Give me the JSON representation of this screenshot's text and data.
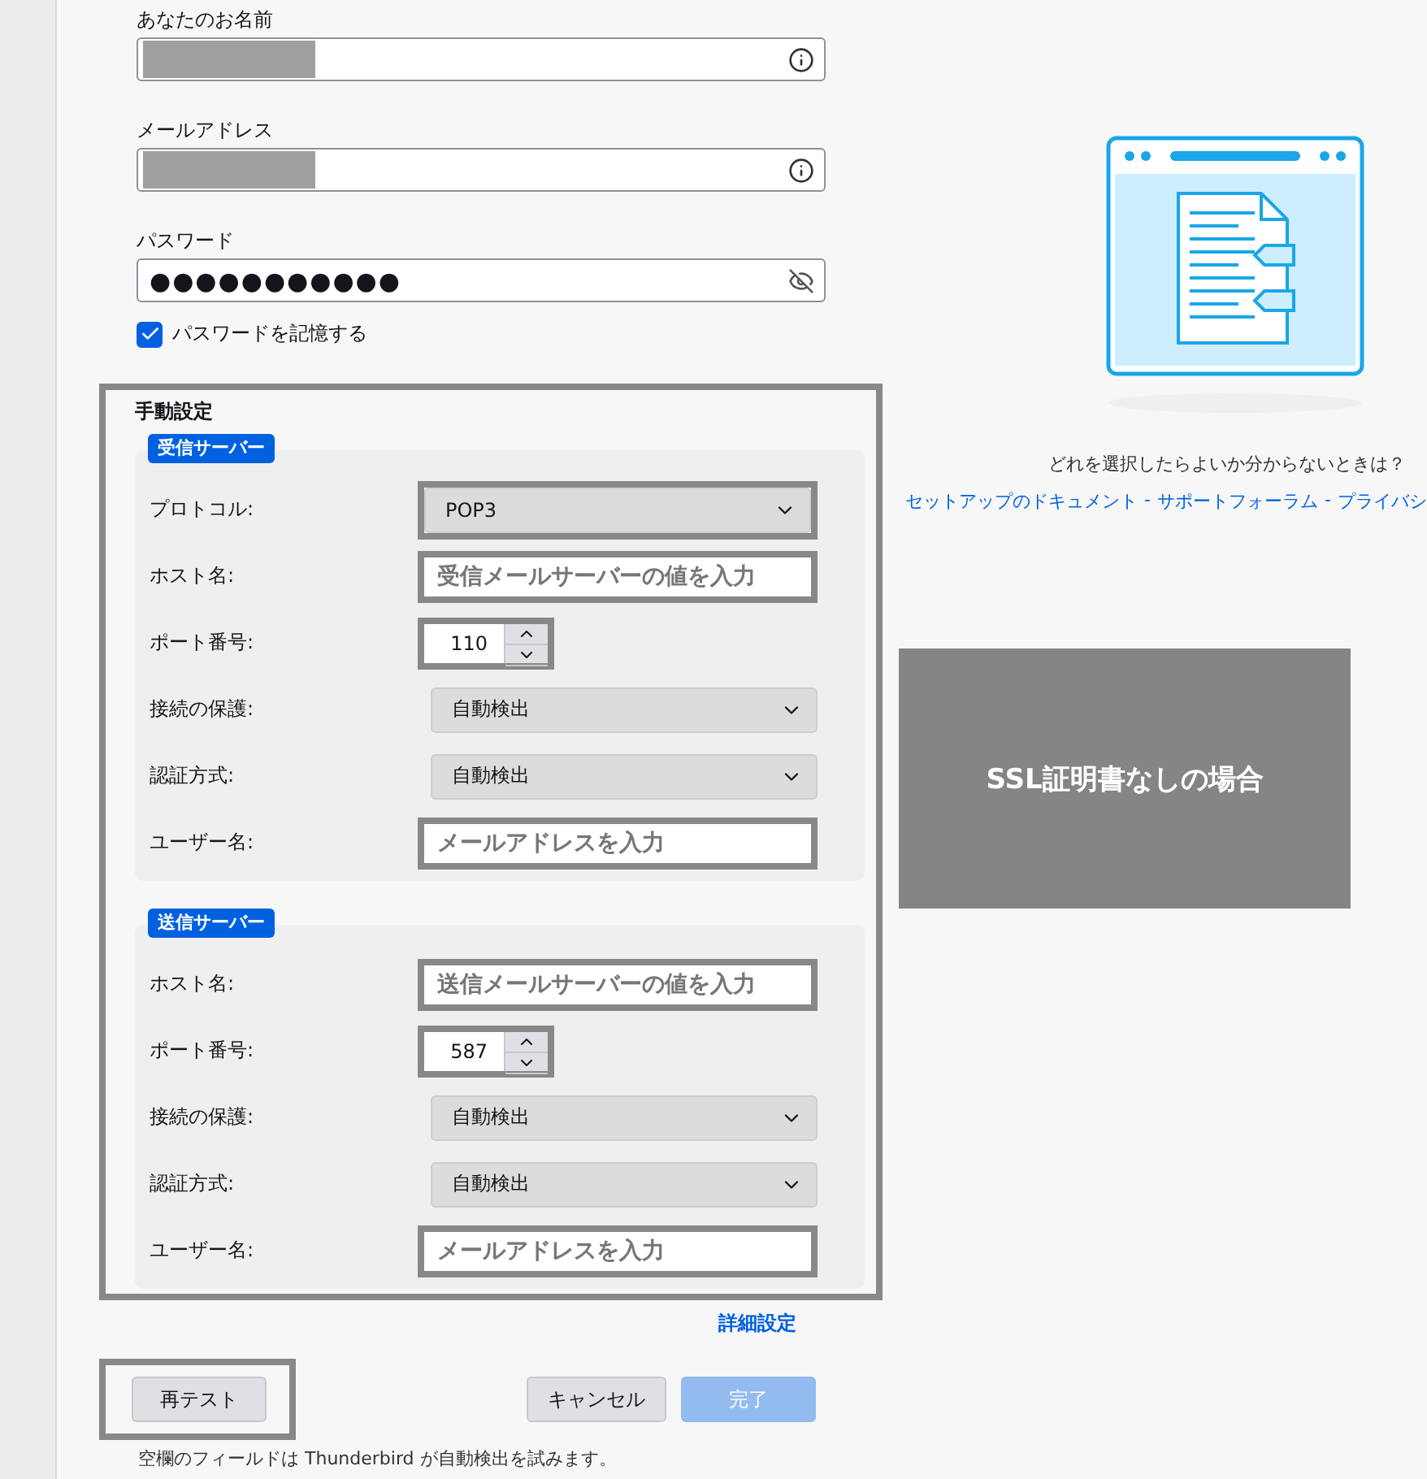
{
  "account": {
    "fields": [
      {
        "label": "あなたのお名前",
        "kind": "redacted"
      },
      {
        "label": "メールアドレス",
        "kind": "redacted"
      },
      {
        "label": "パスワード",
        "kind": "password",
        "value": "●●●●●●●●●●●"
      }
    ],
    "remember_password": {
      "label": "パスワードを記憶する",
      "checked": true
    }
  },
  "manual_settings": {
    "title": "手動設定",
    "highlighted": true,
    "sections": [
      {
        "tag": "受信サーバー",
        "rows": [
          {
            "label": "プロトコル:",
            "kind": "select",
            "value": "POP3",
            "highlighted": true
          },
          {
            "label": "ホスト名:",
            "kind": "text",
            "value": "受信メールサーバーの値を入力",
            "highlighted": true
          },
          {
            "label": "ポート番号:",
            "kind": "number",
            "value": "110",
            "highlighted": true
          },
          {
            "label": "接続の保護:",
            "kind": "select",
            "value": "自動検出",
            "highlighted": false
          },
          {
            "label": "認証方式:",
            "kind": "select",
            "value": "自動検出",
            "highlighted": false
          },
          {
            "label": "ユーザー名:",
            "kind": "text",
            "value": "メールアドレスを入力",
            "highlighted": true
          }
        ]
      },
      {
        "tag": "送信サーバー",
        "rows": [
          {
            "label": "ホスト名:",
            "kind": "text",
            "value": "送信メールサーバーの値を入力",
            "highlighted": true
          },
          {
            "label": "ポート番号:",
            "kind": "number",
            "value": "587",
            "highlighted": true
          },
          {
            "label": "接続の保護:",
            "kind": "select",
            "value": "自動検出",
            "highlighted": false
          },
          {
            "label": "認証方式:",
            "kind": "select",
            "value": "自動検出",
            "highlighted": false
          },
          {
            "label": "ユーザー名:",
            "kind": "text",
            "value": "メールアドレスを入力",
            "highlighted": true
          }
        ]
      }
    ]
  },
  "advanced_link": "詳細設定",
  "left_buttons": [
    {
      "label": "再テスト",
      "kind": "secondary",
      "highlighted": true,
      "disabled": false
    }
  ],
  "right_buttons": [
    {
      "label": "キャンセル",
      "kind": "secondary",
      "highlighted": false,
      "disabled": false
    },
    {
      "label": "完了",
      "kind": "primary",
      "highlighted": false,
      "disabled": true
    }
  ],
  "footer_note": "空欄のフィールドは Thunderbird が自動検出を試みます。",
  "help": {
    "question": "どれを選択したらよいか分からないときは？",
    "links": [
      "セットアップのドキュメント",
      "サポートフォーラム",
      "プライバシ"
    ],
    "separators": [
      "-",
      "-"
    ]
  },
  "overlay_note": {
    "text": "SSL証明書なしの場合"
  }
}
